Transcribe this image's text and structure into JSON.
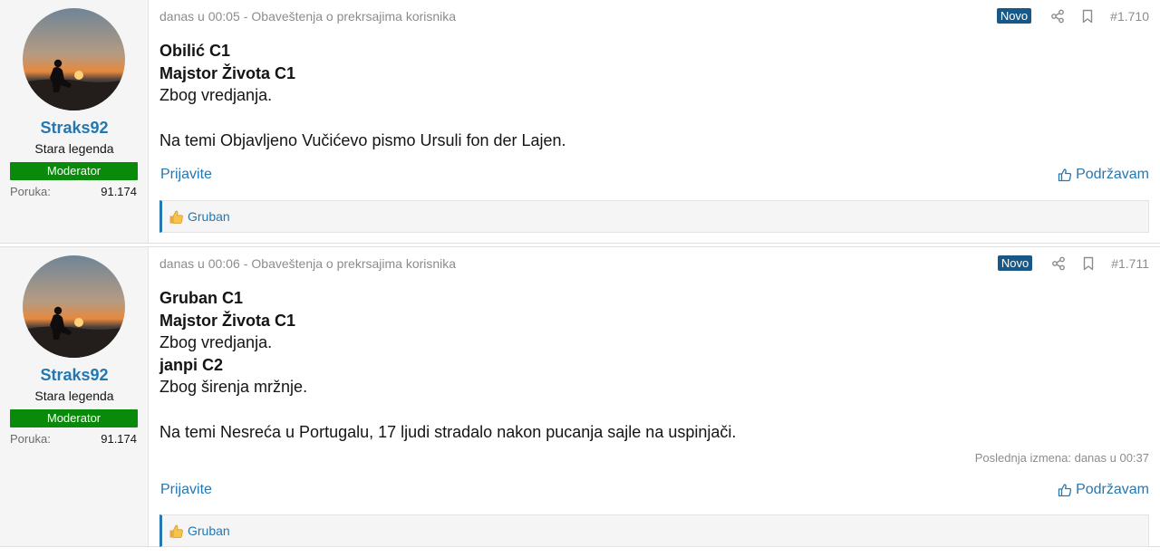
{
  "posts": [
    {
      "author": {
        "username": "Straks92",
        "title": "Stara legenda",
        "banner": "Moderator",
        "stat_label": "Poruka:",
        "stat_value": "91.174"
      },
      "meta": {
        "time": "danas u 00:05",
        "separator": "-",
        "forum": "Obaveštenja o prekrsajima korisnika"
      },
      "badge": "Novo",
      "post_number": "#1.710",
      "lines": [
        {
          "text": "Obilić C1",
          "bold": true
        },
        {
          "text": "Majstor Života C1",
          "bold": true
        },
        {
          "text": "Zbog vredjanja.",
          "bold": false
        },
        {
          "text": "",
          "bold": false
        },
        {
          "text": "Na temi Objavljeno Vučićevo pismo Ursuli fon der Lajen.",
          "bold": false
        }
      ],
      "report_label": "Prijavite",
      "like_label": "Podržavam",
      "reactions": "Gruban"
    },
    {
      "author": {
        "username": "Straks92",
        "title": "Stara legenda",
        "banner": "Moderator",
        "stat_label": "Poruka:",
        "stat_value": "91.174"
      },
      "meta": {
        "time": "danas u 00:06",
        "separator": "-",
        "forum": "Obaveštenja o prekrsajima korisnika"
      },
      "badge": "Novo",
      "post_number": "#1.711",
      "lines": [
        {
          "text": "Gruban C1",
          "bold": true
        },
        {
          "text": "Majstor Života C1",
          "bold": true
        },
        {
          "text": "Zbog vredjanja.",
          "bold": false
        },
        {
          "text": "janpi C2",
          "bold": true
        },
        {
          "text": "Zbog širenja mržnje.",
          "bold": false
        },
        {
          "text": "",
          "bold": false
        },
        {
          "text": "Na temi Nesreća u Portugalu, 17 ljudi stradalo nakon pucanja sajle na uspinjači.",
          "bold": false
        }
      ],
      "last_edit": "Poslednja izmena: danas u 00:37",
      "report_label": "Prijavite",
      "like_label": "Podržavam",
      "reactions": "Gruban"
    }
  ],
  "icons": {
    "share": "share-icon",
    "bookmark": "bookmark-icon",
    "like": "thumbs-up-icon",
    "reaction": "thumbs-up-emoji-icon"
  },
  "colors": {
    "link": "#2577b1",
    "badge": "#185886",
    "moderator_banner": "#0a8a0a",
    "muted": "#8c8c8c"
  }
}
